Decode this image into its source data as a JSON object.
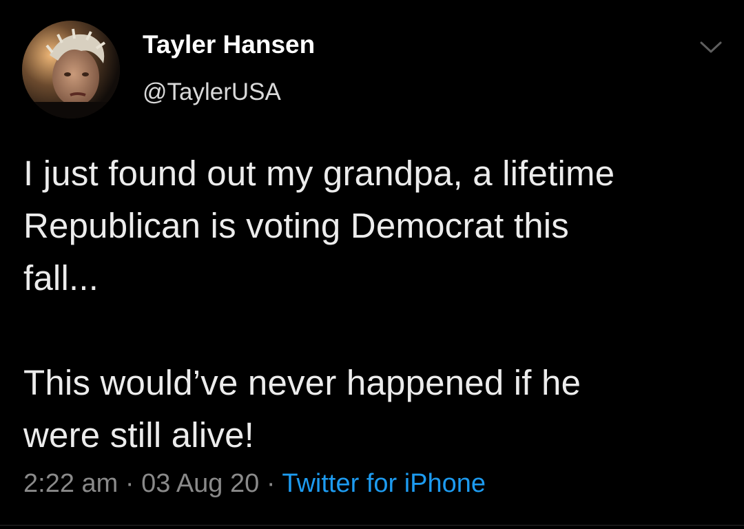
{
  "author": {
    "display_name": "Tayler Hansen",
    "handle": "@TaylerUSA"
  },
  "icons": {
    "menu": "chevron-down-icon",
    "avatar": "profile-photo"
  },
  "tweet": {
    "text": "I just found out my grandpa, a lifetime\nRepublican is voting Democrat this\nfall...\n\nThis would’ve never happened if he\nwere still alive!"
  },
  "meta": {
    "time": "2:22 am",
    "separator_1": " · ",
    "date": "03 Aug 20",
    "separator_2": " · ",
    "source": "Twitter for iPhone"
  },
  "colors": {
    "background": "#000000",
    "text": "#ececec",
    "muted": "#8a8a8a",
    "link": "#1d9bf0"
  }
}
